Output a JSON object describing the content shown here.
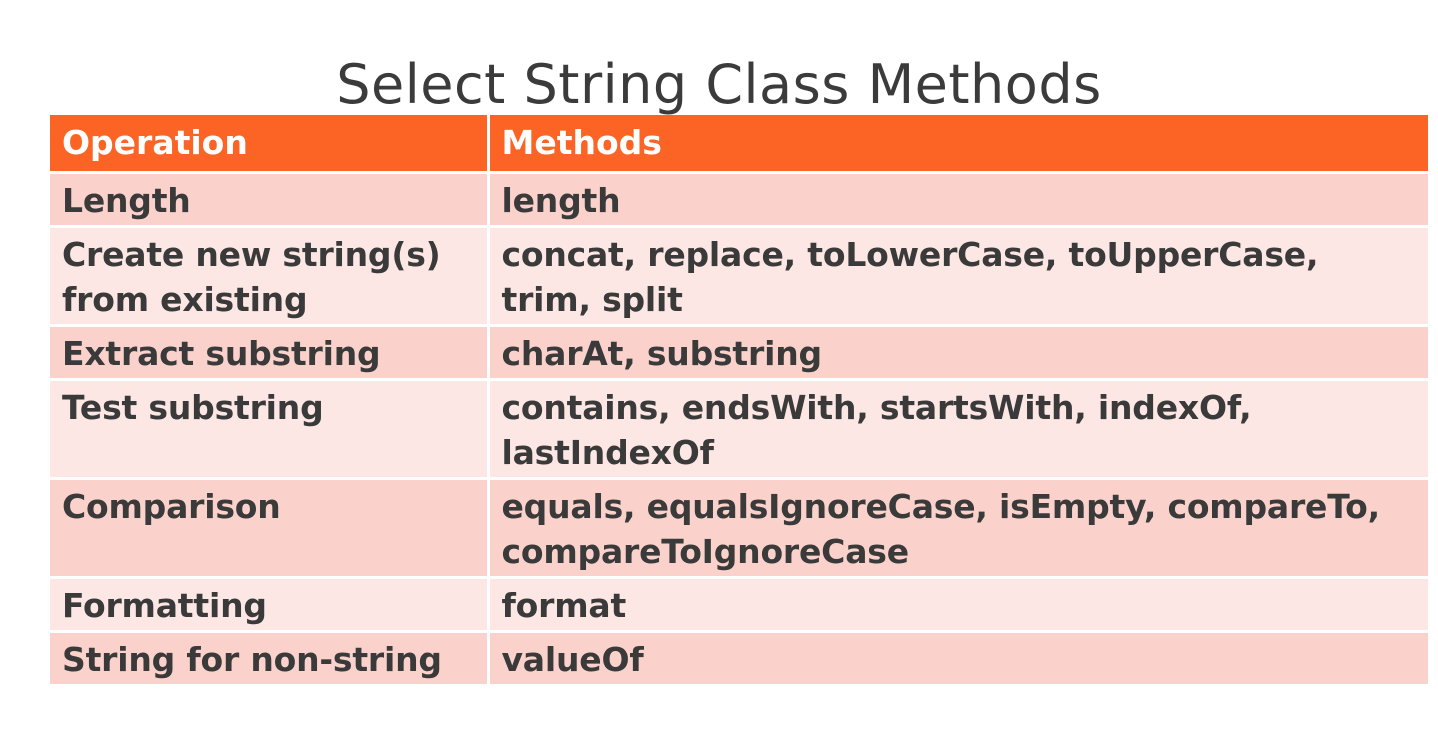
{
  "title": "Select String Class Methods",
  "table": {
    "headers": {
      "operation": "Operation",
      "methods": "Methods"
    },
    "rows": [
      {
        "operation": "Length",
        "methods": "length",
        "shade": "dark"
      },
      {
        "operation": "Create new string(s) from existing",
        "methods": "concat, replace, toLowerCase, toUpperCase, trim, split",
        "shade": "light"
      },
      {
        "operation": "Extract substring",
        "methods": "charAt, substring",
        "shade": "dark"
      },
      {
        "operation": "Test substring",
        "methods": "contains, endsWith, startsWith, indexOf, lastIndexOf",
        "shade": "light"
      },
      {
        "operation": "Comparison",
        "methods": "equals, equalsIgnoreCase, isEmpty, compareTo, compareToIgnoreCase",
        "shade": "dark"
      },
      {
        "operation": "Formatting",
        "methods": "format",
        "shade": "light"
      },
      {
        "operation": "String for non-string",
        "methods": "valueOf",
        "shade": "dark"
      }
    ]
  },
  "colors": {
    "header_bg": "#fb6424",
    "header_text": "#ffffff",
    "row_dark": "#fbd2cb",
    "row_light": "#fce7e4",
    "body_text": "#3a3a3a",
    "title_text": "#3b3b3b"
  }
}
